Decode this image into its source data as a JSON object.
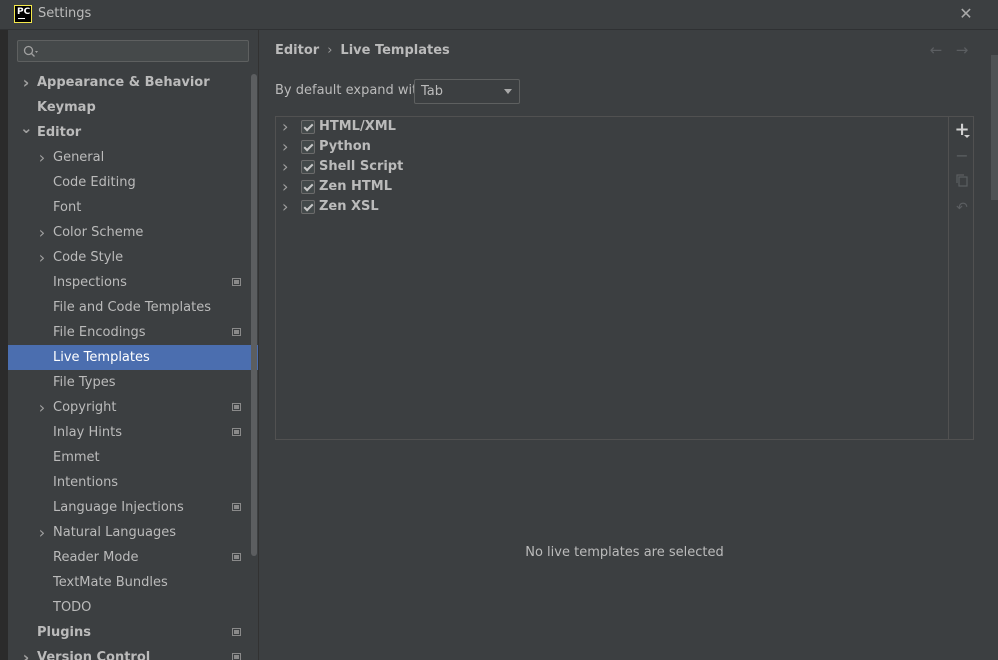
{
  "window": {
    "title": "Settings",
    "logo_text": "PC"
  },
  "search": {
    "placeholder": ""
  },
  "sidebar": {
    "items": [
      {
        "label": "Appearance & Behavior",
        "level": 0,
        "arrow": "collapsed",
        "bold": true,
        "proj": false
      },
      {
        "label": "Keymap",
        "level": 0,
        "arrow": "none",
        "bold": true,
        "proj": false
      },
      {
        "label": "Editor",
        "level": 0,
        "arrow": "expanded",
        "bold": true,
        "proj": false
      },
      {
        "label": "General",
        "level": 1,
        "arrow": "collapsed",
        "bold": false,
        "proj": false
      },
      {
        "label": "Code Editing",
        "level": 1,
        "arrow": "none",
        "bold": false,
        "proj": false
      },
      {
        "label": "Font",
        "level": 1,
        "arrow": "none",
        "bold": false,
        "proj": false
      },
      {
        "label": "Color Scheme",
        "level": 1,
        "arrow": "collapsed",
        "bold": false,
        "proj": false
      },
      {
        "label": "Code Style",
        "level": 1,
        "arrow": "collapsed",
        "bold": false,
        "proj": false
      },
      {
        "label": "Inspections",
        "level": 1,
        "arrow": "none",
        "bold": false,
        "proj": true
      },
      {
        "label": "File and Code Templates",
        "level": 1,
        "arrow": "none",
        "bold": false,
        "proj": false
      },
      {
        "label": "File Encodings",
        "level": 1,
        "arrow": "none",
        "bold": false,
        "proj": true
      },
      {
        "label": "Live Templates",
        "level": 1,
        "arrow": "none",
        "bold": false,
        "proj": false,
        "selected": true
      },
      {
        "label": "File Types",
        "level": 1,
        "arrow": "none",
        "bold": false,
        "proj": false
      },
      {
        "label": "Copyright",
        "level": 1,
        "arrow": "collapsed",
        "bold": false,
        "proj": true
      },
      {
        "label": "Inlay Hints",
        "level": 1,
        "arrow": "none",
        "bold": false,
        "proj": true
      },
      {
        "label": "Emmet",
        "level": 1,
        "arrow": "none",
        "bold": false,
        "proj": false
      },
      {
        "label": "Intentions",
        "level": 1,
        "arrow": "none",
        "bold": false,
        "proj": false
      },
      {
        "label": "Language Injections",
        "level": 1,
        "arrow": "none",
        "bold": false,
        "proj": true
      },
      {
        "label": "Natural Languages",
        "level": 1,
        "arrow": "collapsed",
        "bold": false,
        "proj": false
      },
      {
        "label": "Reader Mode",
        "level": 1,
        "arrow": "none",
        "bold": false,
        "proj": true
      },
      {
        "label": "TextMate Bundles",
        "level": 1,
        "arrow": "none",
        "bold": false,
        "proj": false
      },
      {
        "label": "TODO",
        "level": 1,
        "arrow": "none",
        "bold": false,
        "proj": false
      },
      {
        "label": "Plugins",
        "level": 0,
        "arrow": "none",
        "bold": true,
        "proj": true
      },
      {
        "label": "Version Control",
        "level": 0,
        "arrow": "collapsed",
        "bold": true,
        "proj": true
      }
    ]
  },
  "breadcrumb": {
    "parent": "Editor",
    "separator": "›",
    "current": "Live Templates"
  },
  "expand": {
    "label": "By default expand with",
    "value": "Tab"
  },
  "templates": [
    {
      "label": "HTML/XML",
      "checked": true
    },
    {
      "label": "Python",
      "checked": true
    },
    {
      "label": "Shell Script",
      "checked": true
    },
    {
      "label": "Zen HTML",
      "checked": true
    },
    {
      "label": "Zen XSL",
      "checked": true
    }
  ],
  "empty_message": "No live templates are selected",
  "colors": {
    "background": "#3c3f41",
    "selection": "#4b6eaf",
    "text": "#bbbbbb"
  }
}
